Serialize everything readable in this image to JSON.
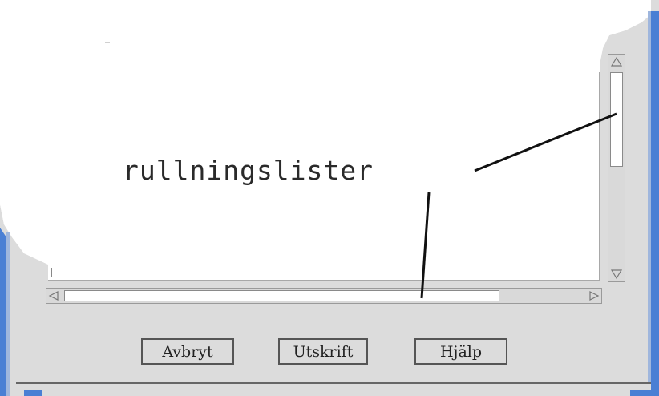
{
  "annotation": {
    "text": "rullningslister"
  },
  "buttons": {
    "cancel": "Avbryt",
    "print": "Utskrift",
    "help": "Hjälp"
  },
  "colors": {
    "dialog_bg": "#dcdcdc",
    "content_bg": "#ffffff",
    "window_border": "#4a7fd4",
    "scroll_track": "#d9d9d9"
  }
}
